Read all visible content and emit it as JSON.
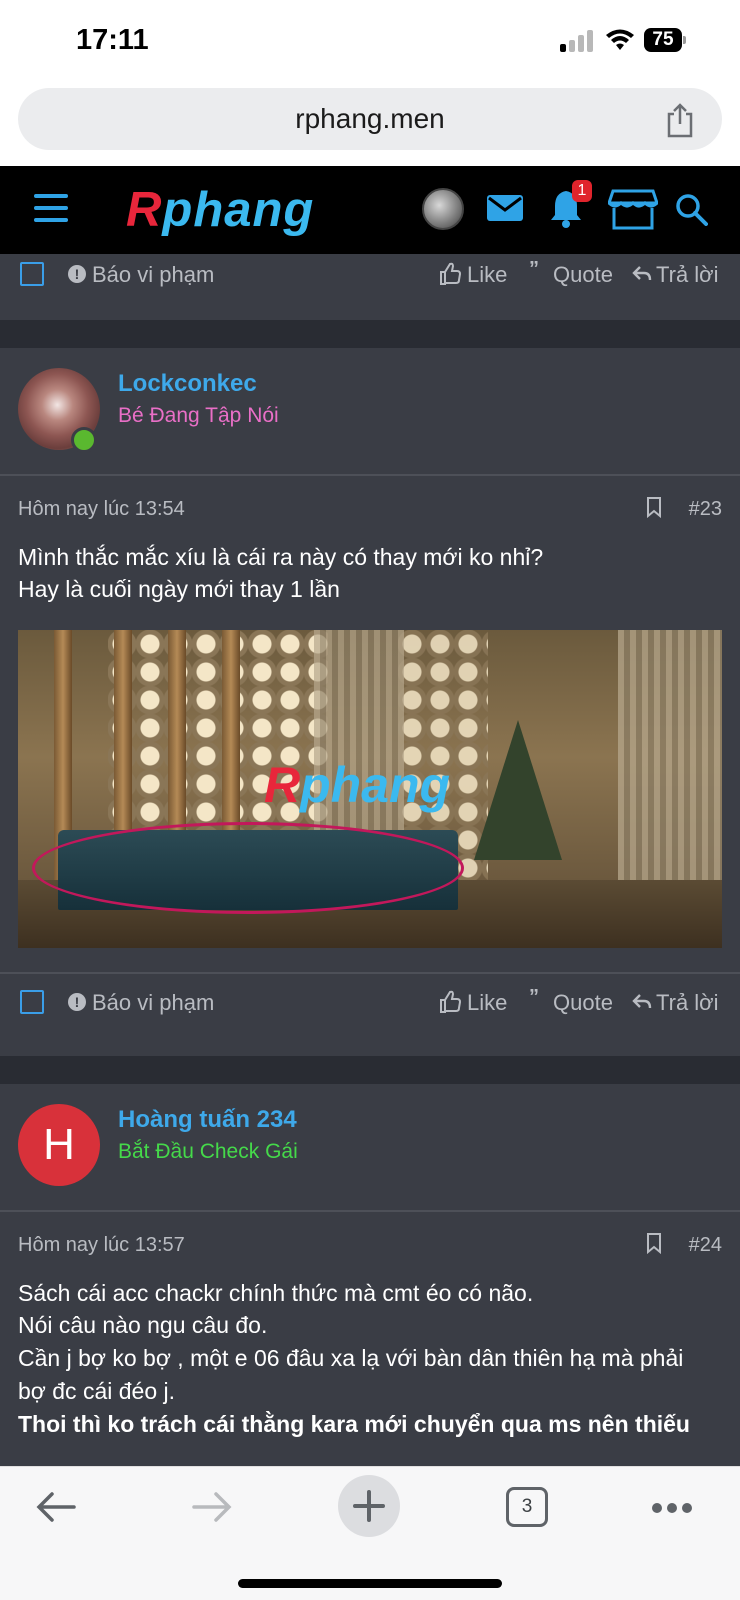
{
  "status": {
    "time": "17:11",
    "battery": "75"
  },
  "browser": {
    "url": "rphang.men",
    "tab_count": "3"
  },
  "site": {
    "logo_part1": "R",
    "logo_part2": "phang",
    "notification_count": "1"
  },
  "actions": {
    "report": "Báo vi phạm",
    "like": "Like",
    "quote": "Quote",
    "reply": "Trả lời"
  },
  "posts": [
    {
      "username": "Lockconkec",
      "user_title": "Bé Đang Tập Nói",
      "user_title_color": "#e96fc7",
      "time": "Hôm nay lúc 13:54",
      "number": "#23",
      "lines": [
        "Mình thắc mắc xíu là cái ra này có thay mới ko nhỉ?",
        "Hay là cuối ngày mới thay 1 lần"
      ],
      "attachment_watermark": "Rphang"
    },
    {
      "username": "Hoàng tuấn 234",
      "avatar_letter": "H",
      "user_title": "Bắt Đầu Check Gái",
      "user_title_color": "#45d94a",
      "time": "Hôm nay lúc 13:57",
      "number": "#24",
      "lines": [
        "Sách cái acc chackr chính thức mà cmt éo có não.",
        "Nói câu nào ngu câu đo.",
        "Cần j bợ ko bợ , một e 06 đâu xa lạ với bàn dân thiên hạ mà phải",
        "bợ đc cái đéo j.",
        "Thoi thì ko trách cái thằng kara mới chuyển qua ms nên thiếu"
      ]
    }
  ],
  "colors": {
    "accent": "#3ea9ea",
    "page_bg": "#292c33",
    "post_bg": "#3a3d45",
    "muted_text": "#b9bcc2"
  }
}
